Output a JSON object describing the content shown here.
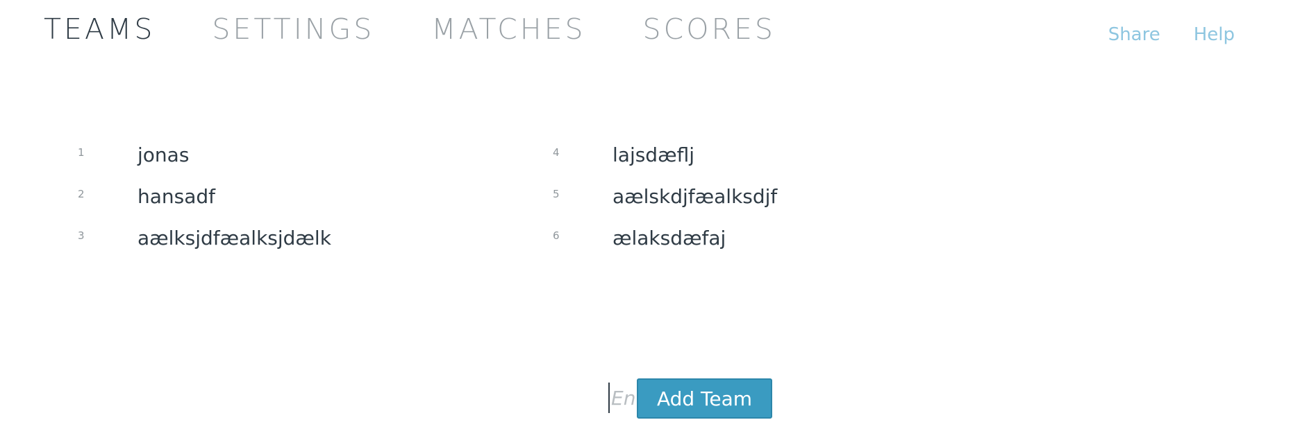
{
  "nav": {
    "tabs": [
      {
        "label": "TEAMS",
        "active": true
      },
      {
        "label": "SETTINGS",
        "active": false
      },
      {
        "label": "MATCHES",
        "active": false
      },
      {
        "label": "SCORES",
        "active": false
      }
    ],
    "links": [
      {
        "label": "Share"
      },
      {
        "label": "Help"
      }
    ]
  },
  "teams": [
    {
      "number": "1",
      "name": "jonas"
    },
    {
      "number": "2",
      "name": "hansadf"
    },
    {
      "number": "3",
      "name": "aælksjdfæalksjdælk"
    },
    {
      "number": "4",
      "name": "lajsdæflj"
    },
    {
      "number": "5",
      "name": "aælskdjfæalksdjf"
    },
    {
      "number": "6",
      "name": "ælaksdæfaj"
    }
  ],
  "add_form": {
    "input_placeholder": "Enter team",
    "input_value": "",
    "button_label": "Add Team"
  },
  "colors": {
    "text": "#2f3b45",
    "inactive_tab": "#9aa1a6",
    "link": "#8ec6e0",
    "button_bg": "#3a9bc1"
  }
}
